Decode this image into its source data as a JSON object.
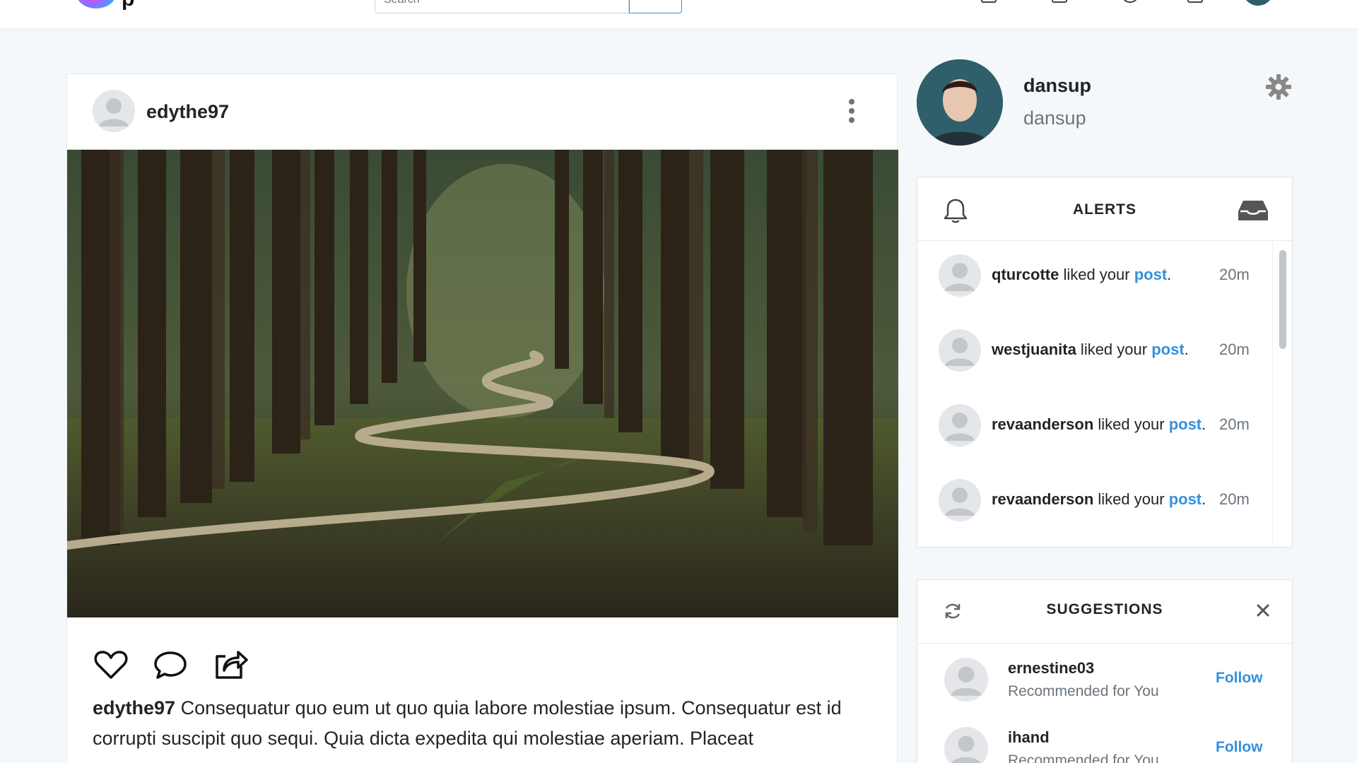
{
  "app": {
    "logo_text": "p",
    "search_placeholder": "Search"
  },
  "post": {
    "author": "edythe97",
    "caption_user": "edythe97",
    "caption_text": "Consequatur quo eum ut quo quia labore molestiae ipsum. Consequatur est id corrupti suscipit quo sequi. Quia dicta expedita qui molestiae aperiam. Placeat",
    "image_icon": "forest-path-photo"
  },
  "profile": {
    "name": "dansup",
    "username": "dansup"
  },
  "alerts": {
    "title": "ALERTS",
    "items": [
      {
        "user": "qturcotte",
        "action": " liked your ",
        "link": "post",
        "suffix": ".",
        "time": "20m"
      },
      {
        "user": "westjuanita",
        "action": " liked your ",
        "link": "post",
        "suffix": ".",
        "time": "20m"
      },
      {
        "user": "revaanderson",
        "action": " liked your ",
        "link": "post",
        "suffix": ".",
        "time": "20m"
      },
      {
        "user": "revaanderson",
        "action": " liked your ",
        "link": "post",
        "suffix": ".",
        "time": "20m"
      }
    ]
  },
  "suggestions": {
    "title": "SUGGESTIONS",
    "items": [
      {
        "username": "ernestine03",
        "reason": "Recommended for You",
        "action": "Follow"
      },
      {
        "username": "ihand",
        "reason": "Recommended for You",
        "action": "Follow"
      }
    ]
  },
  "colors": {
    "accent": "#3490dc",
    "background": "#f5f8fa",
    "muted": "#6c757d"
  }
}
